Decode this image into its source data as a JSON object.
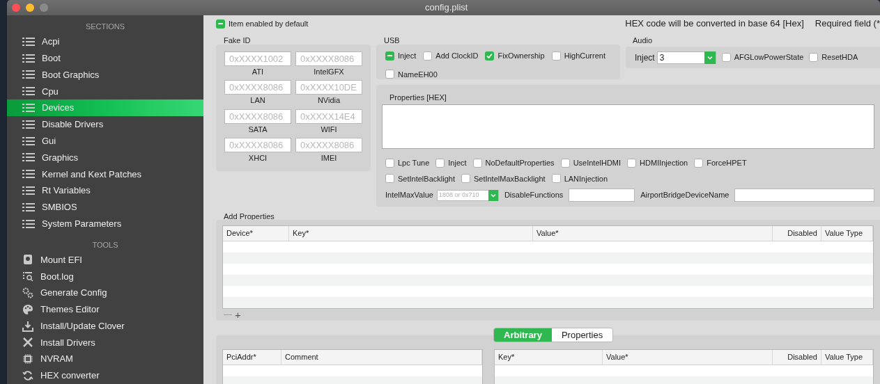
{
  "window": {
    "title": "config.plist"
  },
  "sidebar": {
    "sections_header": "SECTIONS",
    "sections": [
      {
        "label": "Acpi",
        "selected": false
      },
      {
        "label": "Boot",
        "selected": false
      },
      {
        "label": "Boot Graphics",
        "selected": false
      },
      {
        "label": "Cpu",
        "selected": false
      },
      {
        "label": "Devices",
        "selected": true
      },
      {
        "label": "Disable Drivers",
        "selected": false
      },
      {
        "label": "Gui",
        "selected": false
      },
      {
        "label": "Graphics",
        "selected": false
      },
      {
        "label": "Kernel and Kext Patches",
        "selected": false
      },
      {
        "label": "Rt Variables",
        "selected": false
      },
      {
        "label": "SMBIOS",
        "selected": false
      },
      {
        "label": "System Parameters",
        "selected": false
      }
    ],
    "tools_header": "TOOLS",
    "tools": [
      {
        "label": "Mount EFI",
        "selected": false
      },
      {
        "label": "Boot.log",
        "selected": false
      },
      {
        "label": "Generate Config",
        "selected": false
      },
      {
        "label": "Themes Editor",
        "selected": false
      },
      {
        "label": "Install/Update Clover",
        "selected": false
      },
      {
        "label": "Install Drivers",
        "selected": false
      },
      {
        "label": "NVRAM",
        "selected": false
      },
      {
        "label": "HEX converter",
        "selected": false
      }
    ]
  },
  "item_enabled": {
    "label": "Item enabled by default",
    "checked": true,
    "mixed": true
  },
  "notes": [
    "HEX code will be converted in base 64 [Hex]",
    "Required field (*"
  ],
  "fake_id": {
    "title": "Fake ID",
    "fields": [
      {
        "placeholder": "0xXXXX1002",
        "label": "ATI"
      },
      {
        "placeholder": "0xXXXX8086",
        "label": "IntelGFX"
      },
      {
        "placeholder": "0xXXXX8086",
        "label": "LAN"
      },
      {
        "placeholder": "0xXXXX10DE",
        "label": "NVidia"
      },
      {
        "placeholder": "0xXXXX8086",
        "label": "SATA"
      },
      {
        "placeholder": "0xXXXX14E4",
        "label": "WIFI"
      },
      {
        "placeholder": "0xXXXX8086",
        "label": "XHCI"
      },
      {
        "placeholder": "0xXXXX8086",
        "label": "IMEI"
      }
    ]
  },
  "usb": {
    "title": "USB",
    "options": [
      {
        "label": "Inject",
        "checked": true,
        "mixed": true
      },
      {
        "label": "Add ClockID",
        "checked": false,
        "mixed": false
      },
      {
        "label": "FixOwnership",
        "checked": true,
        "mixed": false
      },
      {
        "label": "HighCurrent",
        "checked": false,
        "mixed": false
      },
      {
        "label": "NameEH00",
        "checked": false,
        "mixed": false
      }
    ]
  },
  "audio": {
    "title": "Audio",
    "inject_label": "Inject",
    "inject_value": "3",
    "options": [
      {
        "label": "AFGLowPowerState",
        "checked": false,
        "mixed": false
      },
      {
        "label": "ResetHDA",
        "checked": false,
        "mixed": false
      }
    ]
  },
  "properties_hex": {
    "title": "Properties [HEX]",
    "options": [
      {
        "label": "Lpc Tune",
        "checked": false,
        "mixed": false
      },
      {
        "label": "Inject",
        "checked": false,
        "mixed": false
      },
      {
        "label": "NoDefaultProperties",
        "checked": false,
        "mixed": false
      },
      {
        "label": "UseIntelHDMI",
        "checked": false,
        "mixed": false
      },
      {
        "label": "HDMIInjection",
        "checked": false,
        "mixed": false
      },
      {
        "label": "ForceHPET",
        "checked": false,
        "mixed": false
      },
      {
        "label": "SetIntelBacklight",
        "checked": false,
        "mixed": false
      },
      {
        "label": "SetIntelMaxBacklight",
        "checked": false,
        "mixed": false
      },
      {
        "label": "LANInjection",
        "checked": false,
        "mixed": false
      }
    ],
    "intel_max_label": "IntelMaxValue",
    "intel_max_placeholder": "1808 or 0x710",
    "disable_functions_label": "DisableFunctions",
    "airport_label": "AirportBridgeDeviceName"
  },
  "add_properties": {
    "title": "Add Properties",
    "columns": [
      "Device*",
      "Key*",
      "Value*",
      "Disabled",
      "Value Type"
    ],
    "remove": "—",
    "add": "+"
  },
  "tabs": [
    {
      "label": "Arbitrary",
      "selected": true
    },
    {
      "label": "Properties",
      "selected": false
    }
  ],
  "arbitrary_table": {
    "columns": [
      "PciAddr*",
      "Comment"
    ]
  },
  "arbitrary_props_table": {
    "columns": [
      "Key*",
      "Value*",
      "Disabled",
      "Value Type"
    ]
  }
}
